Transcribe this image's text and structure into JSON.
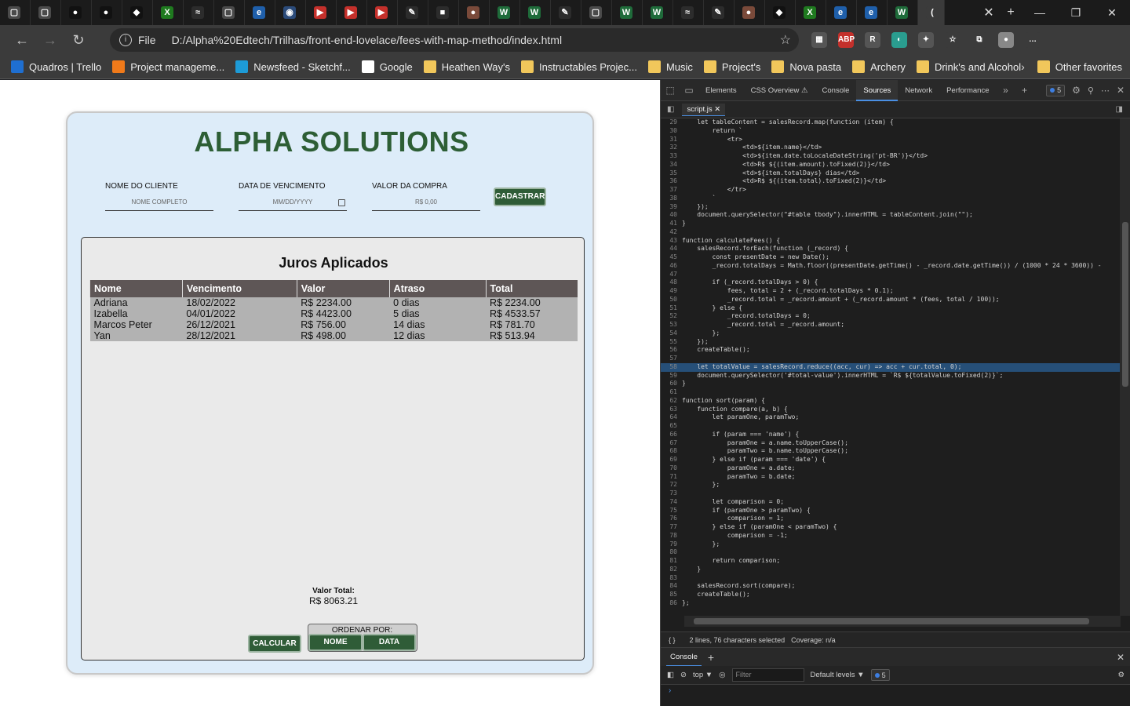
{
  "browser": {
    "tabs": [
      {
        "icon": "page-icon",
        "color": "#4a4a4a",
        "letter": "▢"
      },
      {
        "icon": "page-icon",
        "color": "#4a4a4a",
        "letter": "▢"
      },
      {
        "icon": "github-icon",
        "color": "#111",
        "letter": "●"
      },
      {
        "icon": "github-icon",
        "color": "#111",
        "letter": "●"
      },
      {
        "icon": "figma-like-icon",
        "color": "#111",
        "letter": "◆"
      },
      {
        "icon": "xbox-icon",
        "color": "#1f7a1f",
        "letter": "X"
      },
      {
        "icon": "gitlab-icon",
        "color": "#2c2c2c",
        "letter": "≈"
      },
      {
        "icon": "page-icon",
        "color": "#4a4a4a",
        "letter": "▢"
      },
      {
        "icon": "edge-icon",
        "color": "#1f5faa",
        "letter": "e"
      },
      {
        "icon": "globe-icon",
        "color": "#2b4b7a",
        "letter": "◉"
      },
      {
        "icon": "youtube-icon",
        "color": "#c4302b",
        "letter": "▶"
      },
      {
        "icon": "youtube-icon",
        "color": "#c4302b",
        "letter": "▶"
      },
      {
        "icon": "youtube-icon",
        "color": "#c4302b",
        "letter": "▶"
      },
      {
        "icon": "pen-icon",
        "color": "#2c2c2c",
        "letter": "✎"
      },
      {
        "icon": "camera-icon",
        "color": "#2c2c2c",
        "letter": "■"
      },
      {
        "icon": "avatar-icon",
        "color": "#7a4a3a",
        "letter": "●"
      },
      {
        "icon": "w-icon",
        "color": "#1f6b3a",
        "letter": "W"
      },
      {
        "icon": "w-icon",
        "color": "#1f6b3a",
        "letter": "W"
      },
      {
        "icon": "pen-icon",
        "color": "#2c2c2c",
        "letter": "✎"
      },
      {
        "icon": "page-icon",
        "color": "#4a4a4a",
        "letter": "▢"
      },
      {
        "icon": "w-icon",
        "color": "#1f6b3a",
        "letter": "W"
      },
      {
        "icon": "w-icon",
        "color": "#1f6b3a",
        "letter": "W"
      },
      {
        "icon": "gitlab-icon",
        "color": "#2c2c2c",
        "letter": "≈"
      },
      {
        "icon": "pen-icon",
        "color": "#2c2c2c",
        "letter": "✎"
      },
      {
        "icon": "avatar-icon",
        "color": "#7a4a3a",
        "letter": "●"
      },
      {
        "icon": "figma-like-icon",
        "color": "#111",
        "letter": "◆"
      },
      {
        "icon": "xbox-icon",
        "color": "#1f7a1f",
        "letter": "X"
      },
      {
        "icon": "edge-icon",
        "color": "#1f5faa",
        "letter": "e"
      },
      {
        "icon": "edge-icon",
        "color": "#1f5faa",
        "letter": "e"
      },
      {
        "icon": "w-icon",
        "color": "#1f6b3a",
        "letter": "W"
      },
      {
        "icon": "active-tab-icon",
        "color": "#3b3b3b",
        "letter": "("
      }
    ],
    "url_label": "File",
    "url": "D:/Alpha%20Edtech/Trilhas/front-end-lovelace/fees-with-map-method/index.html",
    "extensions": [
      {
        "icon": "qr-icon",
        "color": "#555",
        "letter": "▦"
      },
      {
        "icon": "abp-icon",
        "color": "#c4302b",
        "letter": "ABP"
      },
      {
        "icon": "reader-icon",
        "color": "#555",
        "letter": "R"
      },
      {
        "icon": "color-icon",
        "color": "#2a9d8f",
        "letter": "◐"
      },
      {
        "icon": "puzzle-icon",
        "color": "#555",
        "letter": "✦"
      },
      {
        "icon": "favorites-icon",
        "color": "#3b3b3b",
        "letter": "☆"
      },
      {
        "icon": "collections-icon",
        "color": "#3b3b3b",
        "letter": "⧉"
      },
      {
        "icon": "profile-icon",
        "color": "#888",
        "letter": "●"
      },
      {
        "icon": "more-icon",
        "color": "#3b3b3b",
        "letter": "…"
      }
    ],
    "bookmarks": [
      {
        "label": "Quadros | Trello",
        "color": "#1f6fd1"
      },
      {
        "label": "Project manageme...",
        "color": "#f07a1a"
      },
      {
        "label": "Newsfeed - Sketchf...",
        "color": "#1d9bd7"
      },
      {
        "label": "Google",
        "color": "#ffffff"
      },
      {
        "label": "Heathen Way's",
        "color": "#f1c75b"
      },
      {
        "label": "Instructables Projec...",
        "color": "#f1c75b"
      },
      {
        "label": "Music",
        "color": "#f1c75b"
      },
      {
        "label": "Project's",
        "color": "#f1c75b"
      },
      {
        "label": "Nova pasta",
        "color": "#f1c75b"
      },
      {
        "label": "Archery",
        "color": "#f1c75b"
      },
      {
        "label": "Drink's and Alcohol",
        "color": "#f1c75b"
      }
    ],
    "other_favorites": "Other favorites"
  },
  "app": {
    "brand": "ALPHA SOLUTIONS",
    "fields": [
      {
        "label": "NOME DO CLIENTE",
        "placeholder": "NOME COMPLETO"
      },
      {
        "label": "DATA DE VENCIMENTO",
        "placeholder": "MM/DD/YYYY"
      },
      {
        "label": "VALOR DA COMPRA",
        "placeholder": "R$ 0,00"
      }
    ],
    "register_button": "CADASTRAR",
    "table_title": "Juros Aplicados",
    "columns": [
      "Nome",
      "Vencimento",
      "Valor",
      "Atraso",
      "Total"
    ],
    "rows": [
      [
        "Adriana",
        "18/02/2022",
        "R$ 2234.00",
        "0 dias",
        "R$ 2234.00"
      ],
      [
        "Izabella",
        "04/01/2022",
        "R$ 4423.00",
        "5 dias",
        "R$ 4533.57"
      ],
      [
        "Marcos Peter",
        "26/12/2021",
        "R$ 756.00",
        "14 dias",
        "R$ 781.70"
      ],
      [
        "Yan",
        "28/12/2021",
        "R$ 498.00",
        "12 dias",
        "R$ 513.94"
      ]
    ],
    "total_label": "Valor Total:",
    "total_value": "R$ 8063.21",
    "calc_button": "CALCULAR",
    "sort_label": "ORDENAR POR:",
    "sort_name_button": "NOME",
    "sort_date_button": "DATA"
  },
  "devtools": {
    "tabs": [
      "Elements",
      "CSS Overview ⚠",
      "Console",
      "Sources",
      "Network",
      "Performance"
    ],
    "active_tab": "Sources",
    "issues_count": "5",
    "file_tab": "script.js",
    "selected_line": "58",
    "code": [
      [
        "29",
        "    let tableContent = salesRecord.map(function (item) {"
      ],
      [
        "30",
        "        return `"
      ],
      [
        "31",
        "            <tr>"
      ],
      [
        "32",
        "                <td>${item.name}</td>"
      ],
      [
        "33",
        "                <td>${item.date.toLocaleDateString('pt-BR')}</td>"
      ],
      [
        "34",
        "                <td>R$ ${(item.amount).toFixed(2)}</td>"
      ],
      [
        "35",
        "                <td>${item.totalDays} dias</td>"
      ],
      [
        "36",
        "                <td>R$ ${(item.total).toFixed(2)}</td>"
      ],
      [
        "37",
        "            </tr>"
      ],
      [
        "38",
        "        `"
      ],
      [
        "39",
        "    });"
      ],
      [
        "40",
        "    document.querySelector(\"#table tbody\").innerHTML = tableContent.join(\"\");"
      ],
      [
        "41",
        "}"
      ],
      [
        "42",
        ""
      ],
      [
        "43",
        "function calculateFees() {"
      ],
      [
        "44",
        "    salesRecord.forEach(function (_record) {"
      ],
      [
        "45",
        "        const presentDate = new Date();"
      ],
      [
        "46",
        "        _record.totalDays = Math.floor((presentDate.getTime() - _record.date.getTime()) / (1000 * 24 * 3600)) -"
      ],
      [
        "47",
        ""
      ],
      [
        "48",
        "        if (_record.totalDays > 0) {"
      ],
      [
        "49",
        "            fees, total = 2 + (_record.totalDays * 0.1);"
      ],
      [
        "50",
        "            _record.total = _record.amount + (_record.amount * (fees, total / 100));"
      ],
      [
        "51",
        "        } else {"
      ],
      [
        "52",
        "            _record.totalDays = 0;"
      ],
      [
        "53",
        "            _record.total = _record.amount;"
      ],
      [
        "54",
        "        };"
      ],
      [
        "55",
        "    });"
      ],
      [
        "56",
        "    createTable();"
      ],
      [
        "57",
        ""
      ],
      [
        "58",
        "    let totalValue = salesRecord.reduce((acc, cur) => acc + cur.total, 0);"
      ],
      [
        "59",
        "    document.querySelector('#total-value').innerHTML = `R$ ${totalValue.toFixed(2)}`;"
      ],
      [
        "60",
        "}"
      ],
      [
        "61",
        ""
      ],
      [
        "62",
        "function sort(param) {"
      ],
      [
        "63",
        "    function compare(a, b) {"
      ],
      [
        "64",
        "        let paramOne, paramTwo;"
      ],
      [
        "65",
        ""
      ],
      [
        "66",
        "        if (param === 'name') {"
      ],
      [
        "67",
        "            paramOne = a.name.toUpperCase();"
      ],
      [
        "68",
        "            paramTwo = b.name.toUpperCase();"
      ],
      [
        "69",
        "        } else if (param === 'date') {"
      ],
      [
        "70",
        "            paramOne = a.date;"
      ],
      [
        "71",
        "            paramTwo = b.date;"
      ],
      [
        "72",
        "        };"
      ],
      [
        "73",
        ""
      ],
      [
        "74",
        "        let comparison = 0;"
      ],
      [
        "75",
        "        if (paramOne > paramTwo) {"
      ],
      [
        "76",
        "            comparison = 1;"
      ],
      [
        "77",
        "        } else if (paramOne < paramTwo) {"
      ],
      [
        "78",
        "            comparison = -1;"
      ],
      [
        "79",
        "        };"
      ],
      [
        "80",
        ""
      ],
      [
        "81",
        "        return comparison;"
      ],
      [
        "82",
        "    }"
      ],
      [
        "83",
        ""
      ],
      [
        "84",
        "    salesRecord.sort(compare);"
      ],
      [
        "85",
        "    createTable();"
      ],
      [
        "86",
        "};"
      ]
    ],
    "status_braces": "{ }",
    "status_selection": "2 lines, 76 characters selected",
    "status_coverage": "Coverage: n/a",
    "console_tab": "Console",
    "console_context": "top",
    "console_filter_placeholder": "Filter",
    "console_levels": "Default levels ▼",
    "console_issues": "5",
    "console_prompt": "›"
  }
}
